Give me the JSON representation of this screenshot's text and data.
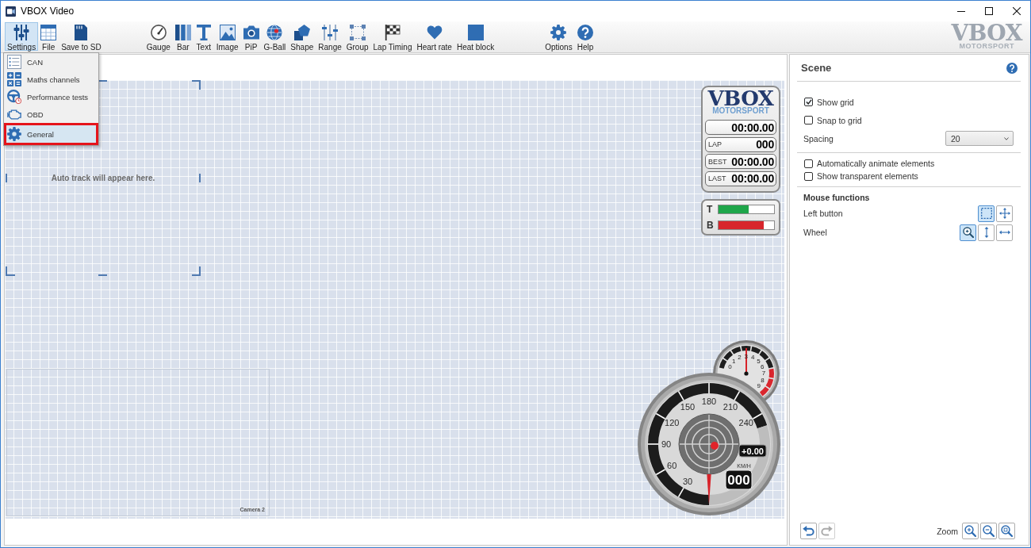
{
  "window": {
    "title": "VBOX Video"
  },
  "toolbar": {
    "groups": [
      {
        "items": [
          {
            "kind": "settings",
            "label": "Settings",
            "selected": true
          },
          {
            "kind": "file",
            "label": "File",
            "selected": false
          },
          {
            "kind": "sdcard",
            "label": "Save to SD",
            "selected": false
          }
        ]
      },
      {
        "items": [
          {
            "kind": "gauge",
            "label": "Gauge",
            "selected": false
          },
          {
            "kind": "bar",
            "label": "Bar",
            "selected": false
          },
          {
            "kind": "text",
            "label": "Text",
            "selected": false
          },
          {
            "kind": "image",
            "label": "Image",
            "selected": false
          },
          {
            "kind": "pip",
            "label": "PiP",
            "selected": false
          },
          {
            "kind": "gball",
            "label": "G-Ball",
            "selected": false
          },
          {
            "kind": "shape",
            "label": "Shape",
            "selected": false
          },
          {
            "kind": "range",
            "label": "Range",
            "selected": false
          },
          {
            "kind": "group",
            "label": "Group",
            "selected": false
          },
          {
            "kind": "laptiming",
            "label": "Lap Timing",
            "selected": false
          },
          {
            "kind": "heartrate",
            "label": "Heart rate",
            "selected": false
          },
          {
            "kind": "heatblock",
            "label": "Heat block",
            "selected": false
          }
        ]
      },
      {
        "items": [
          {
            "kind": "options",
            "label": "Options",
            "selected": false
          },
          {
            "kind": "help",
            "label": "Help",
            "selected": false
          }
        ]
      }
    ],
    "logo": {
      "title": "VBOX",
      "subtitle": "MOTORSPORT"
    }
  },
  "settings_menu": {
    "items": [
      {
        "kind": "can",
        "label": "CAN",
        "selected": false
      },
      {
        "kind": "maths",
        "label": "Maths channels",
        "selected": false
      },
      {
        "kind": "performance",
        "label": "Performance tests",
        "selected": false
      },
      {
        "kind": "obd",
        "label": "OBD",
        "selected": false
      },
      {
        "kind": "general",
        "label": "General",
        "selected": true
      }
    ]
  },
  "canvas": {
    "auto_track": {
      "message": "Auto track will appear here."
    },
    "camera": {
      "label": "Camera 2"
    },
    "lap_timer": {
      "logo": {
        "title": "VBOX",
        "subtitle": "MOTORSPORT"
      },
      "rows": [
        {
          "value": "00:00.00"
        },
        {
          "label": "LAP",
          "value": "000"
        },
        {
          "label": "BEST",
          "value": "00:00.00"
        },
        {
          "label": "LAST",
          "value": "00:00.00"
        }
      ]
    },
    "pedals": [
      {
        "label": "T",
        "level": 0.54,
        "color": "#1fa64a"
      },
      {
        "label": "B",
        "level": 0.82,
        "color": "#d7262c"
      }
    ],
    "tachometer": {
      "scale": [
        "0",
        "1",
        "2",
        "3",
        "4",
        "5",
        "6",
        "7",
        "8",
        "9"
      ]
    },
    "speedometer": {
      "scale": [
        "30",
        "60",
        "90",
        "120",
        "150",
        "180",
        "210",
        "240"
      ],
      "delta": "+0.00",
      "unit": "KM/H",
      "speed": "000"
    }
  },
  "scene_panel": {
    "title": "Scene",
    "sections": [
      {
        "items": [
          {
            "kind": "checkbox",
            "label": "Show grid",
            "checked": true
          },
          {
            "kind": "checkbox",
            "label": "Snap to grid",
            "checked": false
          },
          {
            "kind": "select",
            "label": "Spacing",
            "value": "20"
          }
        ]
      },
      {
        "items": [
          {
            "kind": "checkbox",
            "label": "Automatically animate elements",
            "checked": false
          },
          {
            "kind": "checkbox",
            "label": "Show transparent elements",
            "checked": false
          }
        ]
      },
      {
        "heading": "Mouse functions",
        "items": [
          {
            "kind": "tools",
            "label": "Left button",
            "tools": [
              {
                "kind": "marquee",
                "selected": true
              },
              {
                "kind": "move",
                "selected": false
              }
            ]
          },
          {
            "kind": "tools",
            "label": "Wheel",
            "tools": [
              {
                "kind": "zoom",
                "selected": true
              },
              {
                "kind": "vertical",
                "selected": false
              },
              {
                "kind": "horizontal",
                "selected": false
              }
            ]
          }
        ]
      }
    ],
    "footer": {
      "history": [
        {
          "kind": "undo",
          "disabled": false
        },
        {
          "kind": "redo",
          "disabled": true
        }
      ],
      "zoom_label": "Zoom",
      "zoom": [
        {
          "kind": "zoomin"
        },
        {
          "kind": "zoomout"
        },
        {
          "kind": "zoomfit"
        }
      ]
    }
  }
}
